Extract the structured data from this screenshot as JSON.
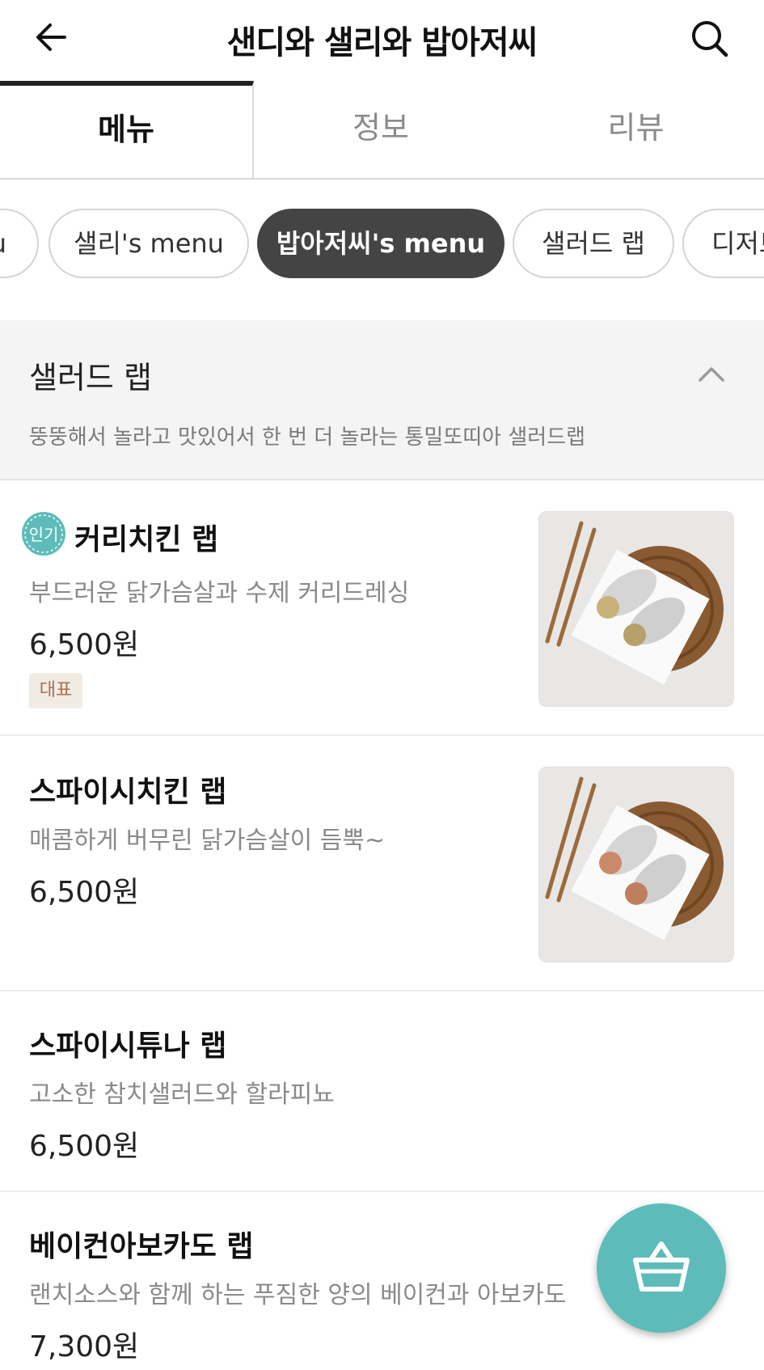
{
  "header": {
    "title": "샌디와 샐리와 밥아저씨",
    "back_icon": "arrow-left-icon",
    "search_icon": "search-icon"
  },
  "tabs": [
    {
      "label": "메뉴",
      "active": true
    },
    {
      "label": "정보",
      "active": false
    },
    {
      "label": "리뷰",
      "active": false
    }
  ],
  "chips": [
    {
      "label": "u",
      "active": false
    },
    {
      "label": "샐리's menu",
      "active": false
    },
    {
      "label": "밥아저씨's menu",
      "active": true
    },
    {
      "label": "샐러드 랩",
      "active": false
    },
    {
      "label": "디저트",
      "active": false
    }
  ],
  "category": {
    "title": "샐러드 랩",
    "description": "뚱뚱해서 놀라고 맛있어서 한 번 더 놀라는 통밀또띠아 샐러드랩",
    "toggle_icon": "chevron-up-icon"
  },
  "items": [
    {
      "name": "커리치킨 랩",
      "description": "부드러운 닭가슴살과 수제 커리드레싱",
      "price": "6,500원",
      "popular_badge": "인기",
      "tag": "대표",
      "has_image": true
    },
    {
      "name": "스파이시치킨 랩",
      "description": "매콤하게 버무린 닭가슴살이 듬뿍~",
      "price": "6,500원",
      "has_image": true
    },
    {
      "name": "스파이시튜나 랩",
      "description": "고소한 참치샐러드와 할라피뇨",
      "price": "6,500원",
      "has_image": false
    },
    {
      "name": "베이컨아보카도 랩",
      "description": "랜치소스와 함께 하는 푸짐한 양의 베이컨과 아보카도",
      "price": "7,300원",
      "has_image": false
    }
  ],
  "cart": {
    "icon": "basket-icon"
  },
  "colors": {
    "accent": "#5dbcb9",
    "active_chip": "#444444",
    "category_bg": "#f4f4f4",
    "tag_bg": "#f2ebe4",
    "tag_text": "#a86f4a"
  }
}
